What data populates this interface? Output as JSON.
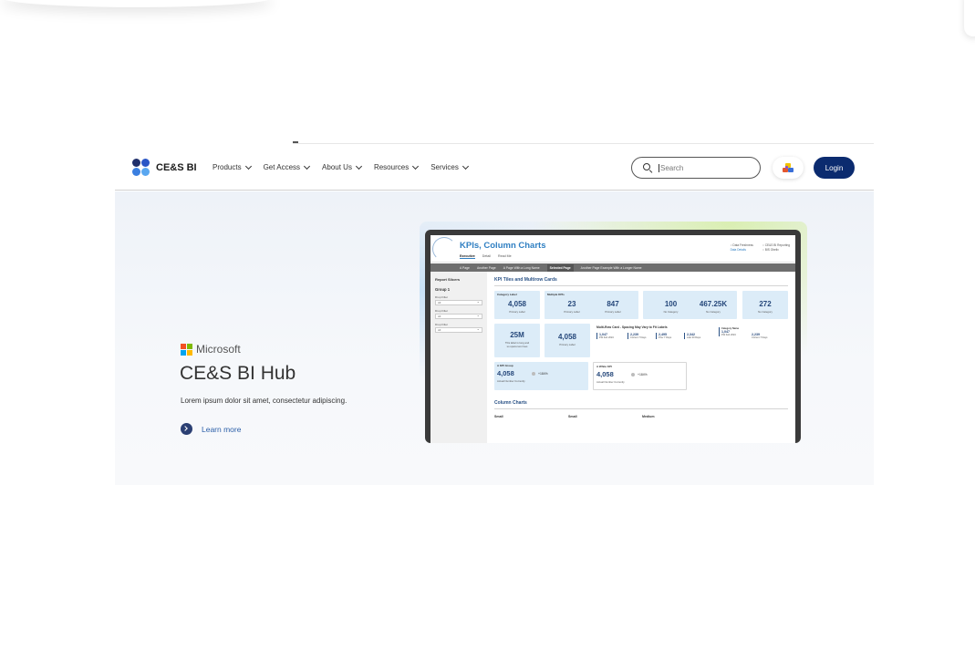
{
  "brand": {
    "name": "CE&S BI"
  },
  "nav": {
    "items": [
      {
        "label": "Products"
      },
      {
        "label": "Get Access"
      },
      {
        "label": "About Us"
      },
      {
        "label": "Resources"
      },
      {
        "label": "Services"
      }
    ]
  },
  "search": {
    "placeholder": "Search",
    "value": ""
  },
  "login": {
    "label": "Login"
  },
  "hero": {
    "partner": "Microsoft",
    "title": "CE&S BI Hub",
    "subtitle": "Lorem ipsum dolor sit amet, consectetur adipiscing.",
    "link": "Learn more"
  },
  "preview": {
    "title": "KPIs, Column Charts",
    "tabs": [
      "Executive",
      "Detail",
      "Read Me"
    ],
    "meta_left": [
      "Data Freshness",
      "Data Details"
    ],
    "meta_right": [
      "CE&S BI Reporting",
      "BIS Obelix"
    ],
    "pages": [
      "A Page",
      "Another Page",
      "A Page With a Long Name",
      "Selected Page",
      "Another Page Example With a Longer Name"
    ],
    "sidebar": {
      "title": "Report Slicers",
      "group": "Group 1",
      "filters": [
        {
          "label": "Drop Filter",
          "value": "All"
        },
        {
          "label": "Drop Filter",
          "value": "All"
        },
        {
          "label": "Drop Filter",
          "value": "All"
        }
      ]
    },
    "section1": "KPI Tiles and Multirow Cards",
    "section2": "Column Charts",
    "cards": {
      "category_label": "Category Label",
      "multiple_kpis": "Multiple KPIs",
      "c1": {
        "value": "4,058",
        "label": "Primary Label"
      },
      "c2": {
        "value": "23",
        "label": "Primary Label"
      },
      "c3": {
        "value": "847",
        "label": "Primary Label"
      },
      "c4": {
        "value": "100",
        "label": "No Category"
      },
      "c5": {
        "value": "467.25K",
        "label": "No Category"
      },
      "c6": {
        "value": "272",
        "label": "No Category"
      },
      "c7": {
        "value": "25M",
        "label1": "This label is long and",
        "label2": "so spans two lines"
      },
      "c8": {
        "value": "4,058",
        "label": "Primary Label"
      },
      "multirow_title": "Multi-Row Card - Spacing May Vary to Fit Labels",
      "multirow": [
        {
          "value": "1,047",
          "label": "FW Feb 2024"
        },
        {
          "value": "2,239",
          "label": "Current 7 Days"
        },
        {
          "value": "2,495",
          "label": "Prev 7 Days"
        },
        {
          "value": "2,342",
          "label": "Last 30 Days"
        }
      ],
      "category_name": "Category Name",
      "multirow2": [
        {
          "value": "1,047",
          "label": "FW Feb 2024"
        },
        {
          "value": "2,239",
          "label": "Current 7 Days"
        }
      ],
      "kpi_group": {
        "label": "A KPI Group",
        "value": "4,058",
        "delta": "+184%",
        "sub": "Actual Number Currently"
      },
      "kpi_white": {
        "label": "A White KPI",
        "value": "4,058",
        "delta": "+184%",
        "sub": "Actual Number Currently"
      }
    },
    "charts": [
      "Small",
      "Small",
      "Medium"
    ]
  }
}
